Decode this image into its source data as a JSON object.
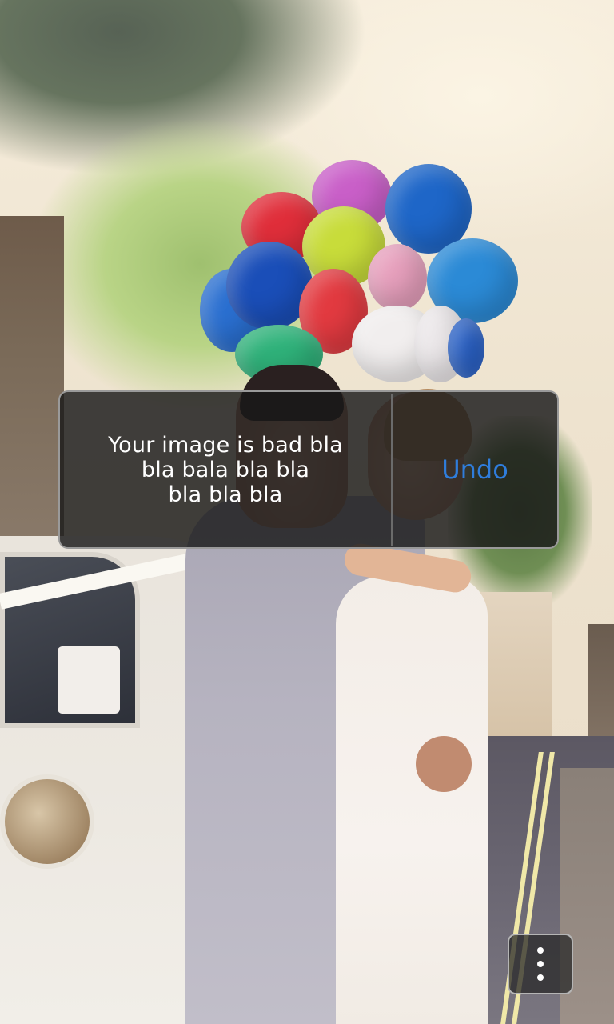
{
  "background": {
    "icon": "photo-background"
  },
  "toast": {
    "message": "Your image is bad bla\nbla bala  bla bla\nbla bla bla",
    "action_label": "Undo",
    "action_color": "#2f7ddc"
  },
  "menu_button": {
    "icon": "overflow-menu-icon"
  }
}
